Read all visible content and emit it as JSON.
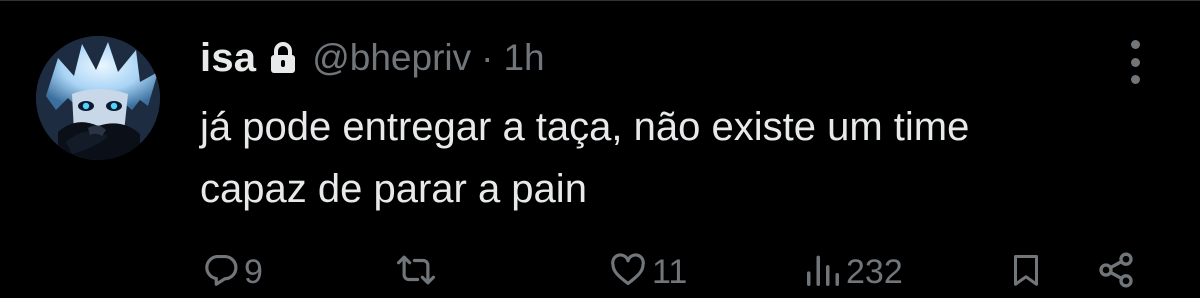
{
  "tweet": {
    "name": "isa",
    "handle": "@bhepriv",
    "separator": "·",
    "time": "1h",
    "text_lines": [
      "já pode entregar a taça, não existe um time",
      "capaz de parar a pain"
    ]
  },
  "actions": {
    "reply_count": "9",
    "retweet_count": "",
    "like_count": "11",
    "view_count": "232"
  },
  "icons": {
    "lock": "lock-icon",
    "more": "more-vertical-icon",
    "reply": "reply-icon",
    "retweet": "retweet-icon",
    "like": "heart-icon",
    "views": "views-icon",
    "bookmark": "bookmark-icon",
    "share": "share-icon"
  },
  "colors": {
    "background": "#000000",
    "primary_text": "#e7e9ea",
    "secondary_text": "#71767b",
    "divider": "#2f3336"
  }
}
